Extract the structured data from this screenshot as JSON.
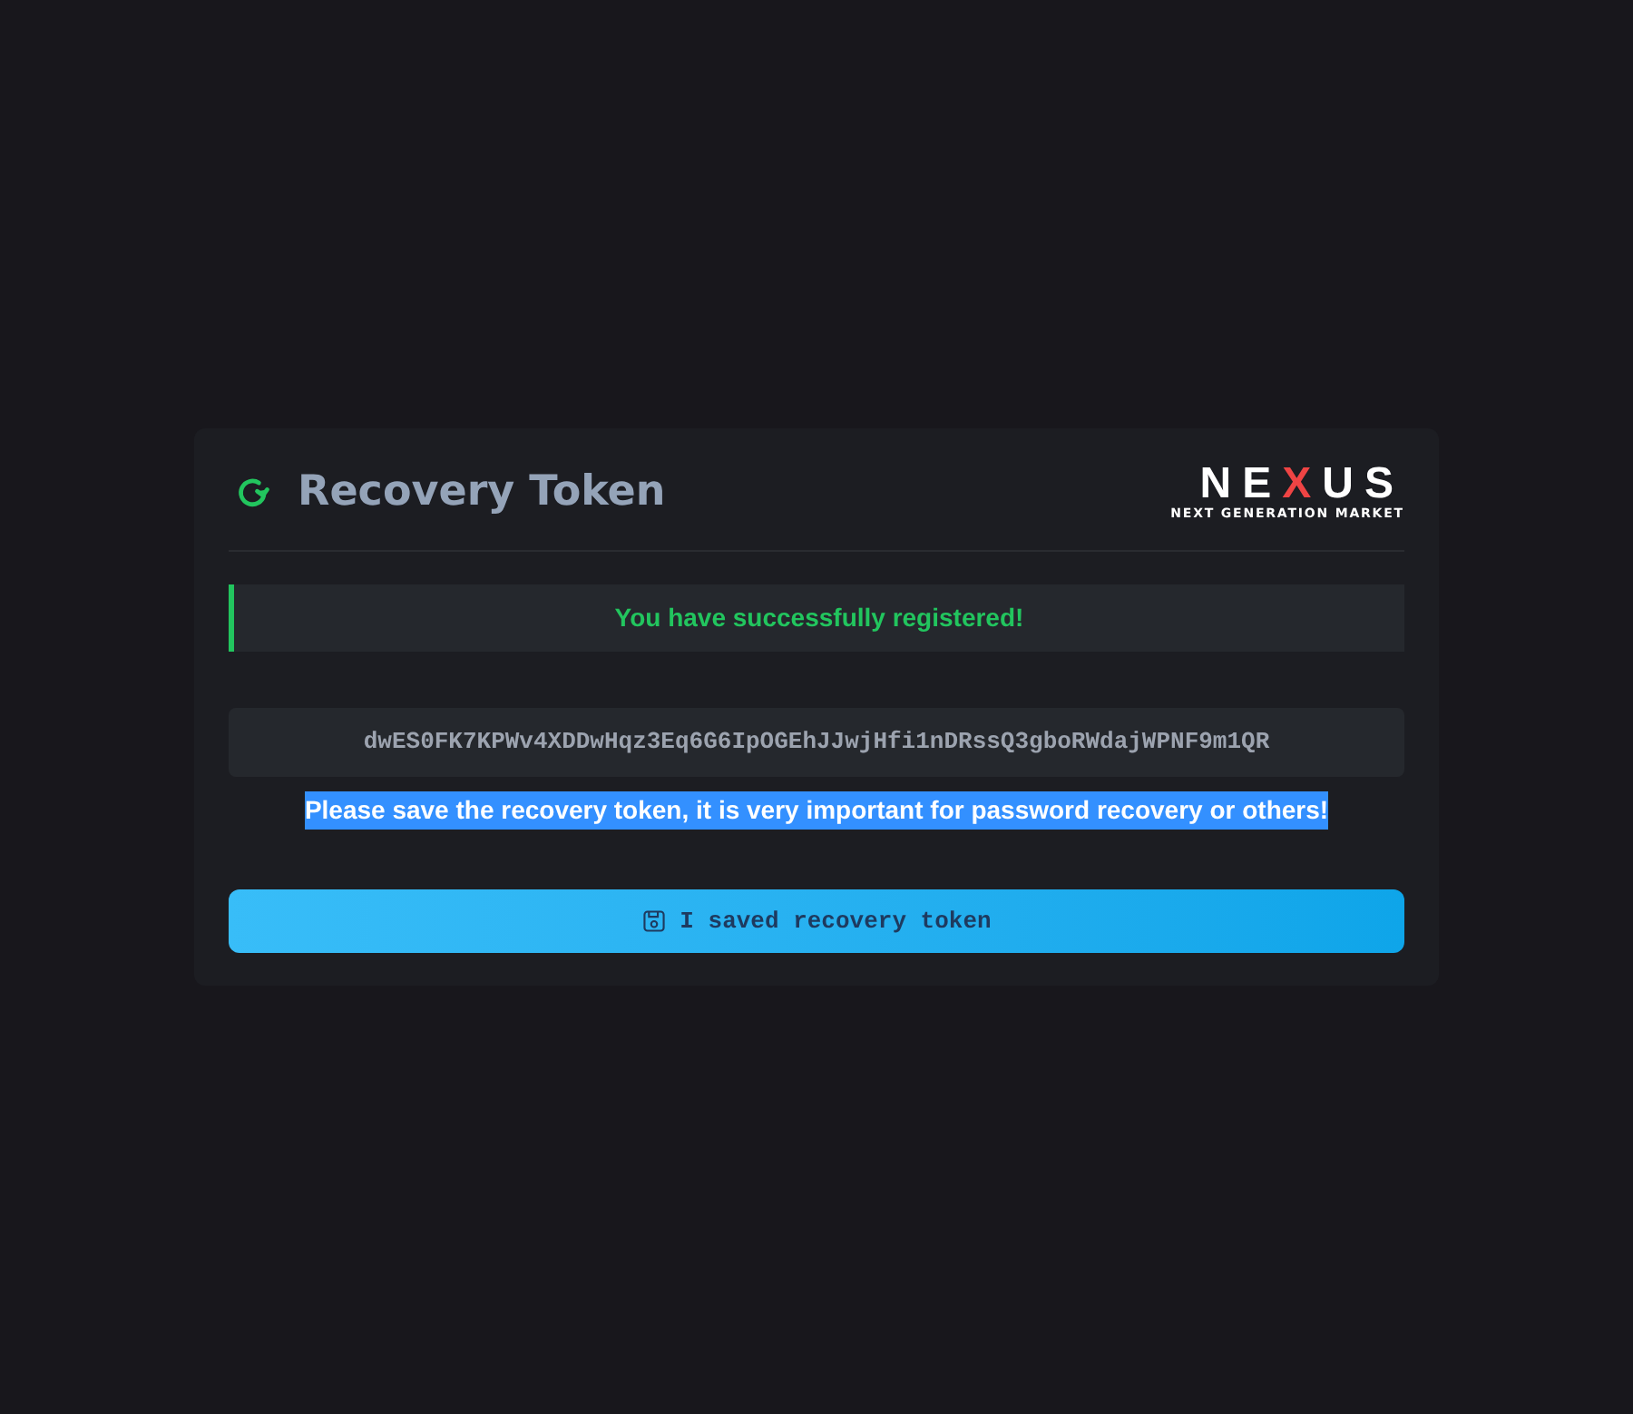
{
  "card": {
    "title": "Recovery Token",
    "logo": {
      "prefix": "NE",
      "accent": "X",
      "suffix": "US",
      "tagline": "NEXT GENERATION MARKET"
    },
    "alert": {
      "kind": "success",
      "message": "You have successfully registered!"
    },
    "token": "dwES0FK7KPWv4XDDwHqz3Eq6G6IpOGEhJJwjHfi1nDRssQ3gboRWdajWPNF9m1QR",
    "warning": {
      "text": "Please save the recovery token, it is very important for password recovery or others!",
      "highlighted": true
    },
    "button": {
      "label": "I saved recovery token"
    }
  }
}
